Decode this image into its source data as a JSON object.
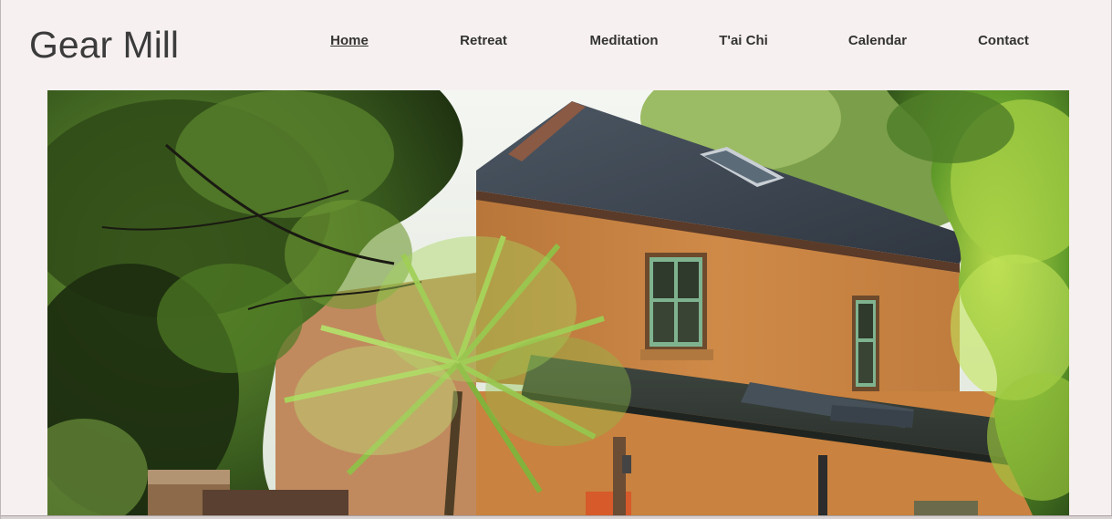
{
  "site": {
    "title": "Gear Mill"
  },
  "nav": {
    "items": [
      {
        "label": "Home",
        "active": true
      },
      {
        "label": "Retreat",
        "active": false
      },
      {
        "label": "Meditation",
        "active": false
      },
      {
        "label": "T'ai Chi",
        "active": false
      },
      {
        "label": "Calendar",
        "active": false
      },
      {
        "label": "Contact",
        "active": false
      }
    ]
  },
  "hero": {
    "subject": "ochre-rendered house with slate roof behind trees and a palm"
  },
  "colors": {
    "background": "#f7f0f0",
    "title_text": "#3b3b3b",
    "nav_text": "#333333"
  }
}
